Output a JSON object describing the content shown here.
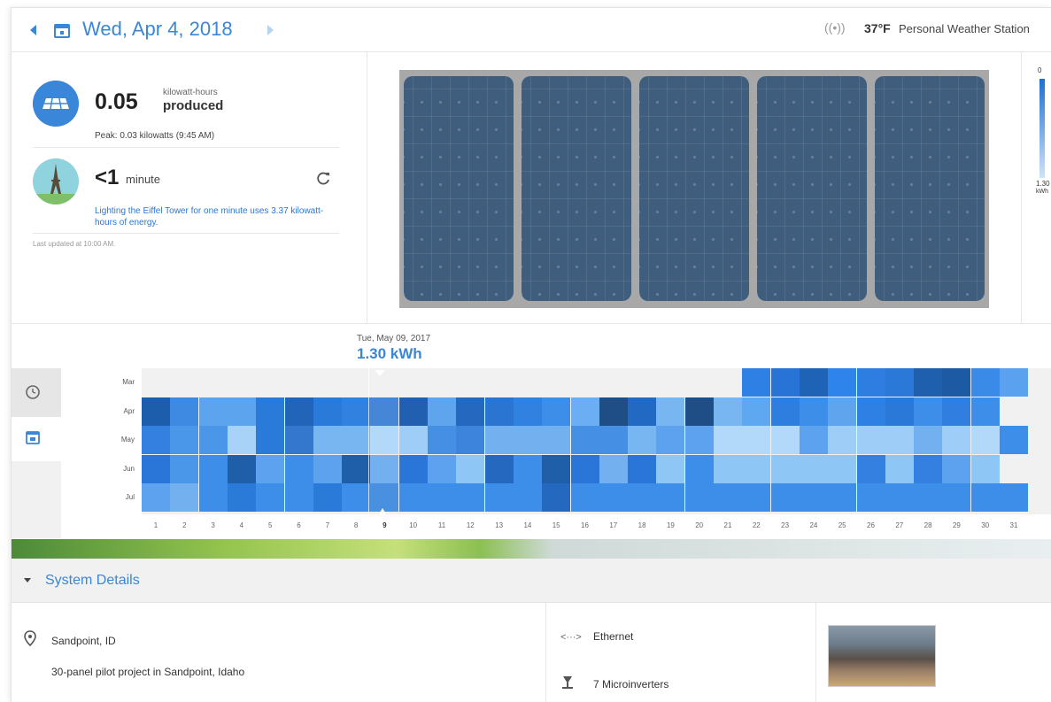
{
  "header": {
    "date": "Wed, Apr 4, 2018",
    "antenna_glyph": "((•))",
    "temperature": "37°F",
    "station": "Personal Weather Station"
  },
  "stats": {
    "energy_value": "0.05",
    "energy_unit": "kilowatt-hours",
    "energy_label": "produced",
    "peak": "Peak: 0.03 kilowatts (9:45 AM)",
    "equivalent_value": "<1",
    "equivalent_unit": "minute",
    "equivalent_description": "Lighting the Eiffel Tower for one minute uses 3.37 kilowatt-hours of energy.",
    "last_updated": "Last updated at 10:00 AM."
  },
  "scale": {
    "min": "0",
    "max": "1.30",
    "unit": "kWh",
    "color_high": "#1d6fd1",
    "color_low": "#cfe3f7"
  },
  "heatmap": {
    "tooltip_date": "Tue, May 09, 2017",
    "tooltip_value": "1.30 kWh",
    "months": [
      "Mar",
      "Apr",
      "May",
      "Jun",
      "Jul"
    ],
    "days": [
      "1",
      "2",
      "3",
      "4",
      "5",
      "6",
      "7",
      "8",
      "9",
      "10",
      "11",
      "12",
      "13",
      "14",
      "15",
      "16",
      "17",
      "18",
      "19",
      "20",
      "21",
      "22",
      "23",
      "24",
      "25",
      "26",
      "27",
      "28",
      "29",
      "30",
      "31"
    ],
    "selected_day": "9",
    "rows": [
      [
        null,
        null,
        null,
        null,
        null,
        null,
        null,
        null,
        null,
        null,
        null,
        null,
        null,
        null,
        null,
        null,
        null,
        null,
        null,
        null,
        null,
        "#2f80e4",
        "#2774d6",
        "#1f63b6",
        "#2f84ec",
        "#2d7ee0",
        "#2a78d8",
        "#1f60ae",
        "#1c5aa4",
        "#3a8ae8",
        "#5aa2f0"
      ],
      [
        "#1d5eac",
        "#3e8ae2",
        "#5da4ef",
        "#5da4ef",
        "#2a7ada",
        "#2164b8",
        "#2a7ada",
        "#3182e0",
        "#4587d6",
        "#2160b0",
        "#5ea5ee",
        "#2468c0",
        "#2a74d2",
        "#3182e0",
        "#3d8ee8",
        "#6caef3",
        "#1f4e86",
        "#2169c2",
        "#78b6f2",
        "#1f4e86",
        "#78b6f2",
        "#5ea8f2",
        "#2e7ee0",
        "#3d8ee8",
        "#5ea5ee",
        "#2f80e4",
        "#2a78d8",
        "#3d8ee8",
        "#2f7ee0",
        "#3d8ee8",
        null
      ],
      [
        "#3380e0",
        "#4a96e8",
        "#4a96e8",
        "#a8d2f8",
        "#2a7ada",
        "#3378cc",
        "#78b6f2",
        "#78b6f2",
        "#b2d8fa",
        "#9ecef8",
        "#4590e4",
        "#3d84dc",
        "#72b0f0",
        "#72b0f0",
        "#72b0f0",
        "#4590e4",
        "#4590e4",
        "#78b6f2",
        "#5ca2ee",
        "#5ca2ee",
        "#b2d8fa",
        "#b2d8fa",
        "#b2d8fa",
        "#5ca2ee",
        "#9ecef8",
        "#9ecef8",
        "#9ecef8",
        "#72b0f0",
        "#9ecef8",
        "#b2d8fa",
        "#3d8ee8"
      ],
      [
        "#2a76d8",
        "#4a96e8",
        "#3d8ee8",
        "#1f5ea8",
        "#5ca2ee",
        "#3d8ee8",
        "#5ca2ee",
        "#1f5ea8",
        "#72b0f0",
        "#2a76d8",
        "#5ca2ee",
        "#8ec6f6",
        "#2468c0",
        "#3d8ee8",
        "#1f5ea8",
        "#2a76d8",
        "#72b0f0",
        "#2a76d8",
        "#8ec6f6",
        "#3d8ee8",
        "#8ec6f6",
        "#8ec6f6",
        "#8ec6f6",
        "#8ec6f6",
        "#8ec6f6",
        "#3380e0",
        "#8ec6f6",
        "#3380e0",
        "#5ca2ee",
        "#8ec6f6",
        null
      ],
      [
        "#5ca2ee",
        "#72b0f0",
        "#3d8ee8",
        "#2a7ada",
        "#3d8ee8",
        "#3d8ee8",
        "#2a7ada",
        "#3d8ee8",
        "#4a90e0",
        "#3d8ee8",
        "#3d8ee8",
        "#3d8ee8",
        "#3d8ee8",
        "#3d8ee8",
        "#2468c0",
        "#3d8ee8",
        "#3d8ee8",
        "#3d8ee8",
        "#3d8ee8",
        "#3d8ee8",
        "#3d8ee8",
        "#3d8ee8",
        "#3d8ee8",
        "#3d8ee8",
        "#3d8ee8",
        "#3d8ee8",
        "#3d8ee8",
        "#3d8ee8",
        "#3d8ee8",
        "#3d8ee8",
        "#3d8ee8"
      ]
    ]
  },
  "system_details": {
    "title": "System Details",
    "location": "Sandpoint, ID",
    "description": "30-panel pilot project in Sandpoint, Idaho",
    "connection_icon": "<···>",
    "connection": "Ethernet",
    "inverters": "7 Microinverters"
  },
  "colors": {
    "accent": "#3a86d8",
    "panel": "#3f5d7c"
  }
}
